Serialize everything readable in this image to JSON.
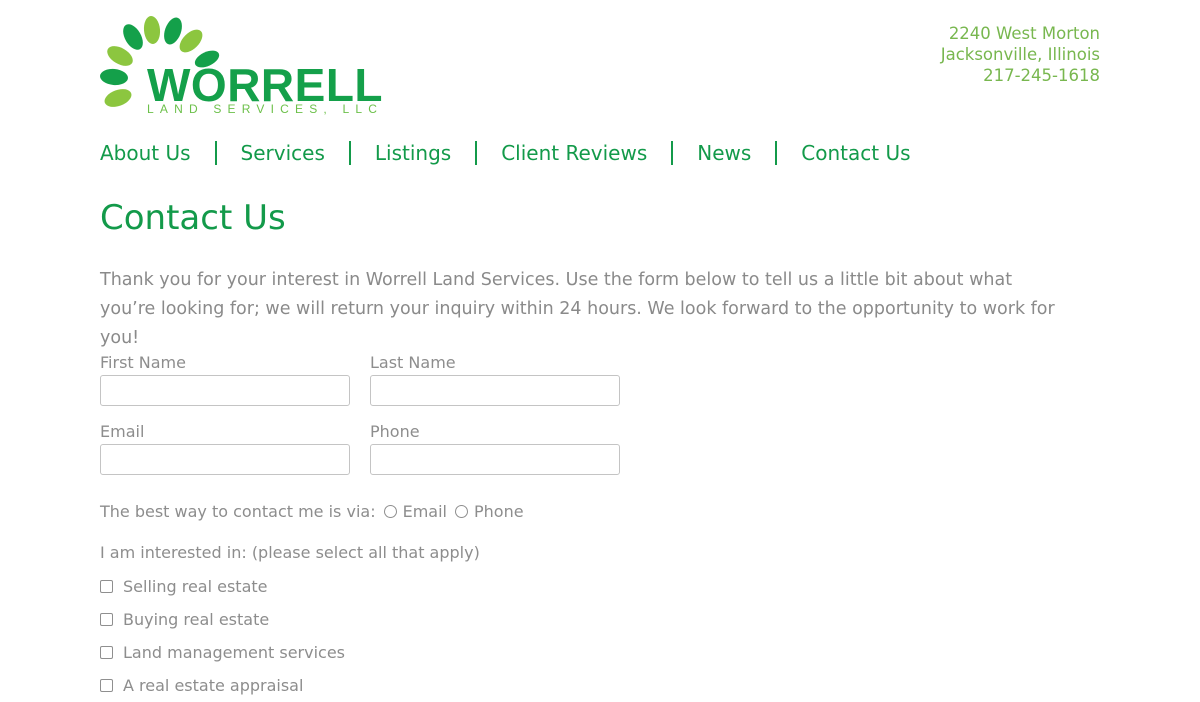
{
  "brand": {
    "name": "WORRELL",
    "subtitle": "LAND SERVICES, LLC",
    "leaf_color_dark": "#14a04a",
    "leaf_color_light": "#8cc63f"
  },
  "address": {
    "street": "2240 West Morton",
    "city": "Jacksonville, Illinois",
    "phone": "217-245-1618"
  },
  "nav": {
    "items": [
      {
        "label": "About Us"
      },
      {
        "label": "Services"
      },
      {
        "label": "Listings"
      },
      {
        "label": "Client Reviews"
      },
      {
        "label": "News"
      },
      {
        "label": "Contact Us"
      }
    ]
  },
  "page": {
    "title": "Contact Us",
    "intro": "Thank you for your interest in Worrell Land Services. Use the form below to tell us a little bit about what you’re looking for; we will return your inquiry within 24 hours. We look forward to the opportunity to work for you!"
  },
  "form": {
    "first_name": {
      "label": "First Name",
      "value": ""
    },
    "last_name": {
      "label": "Last Name",
      "value": ""
    },
    "email": {
      "label": "Email",
      "value": ""
    },
    "phone": {
      "label": "Phone",
      "value": ""
    },
    "contact_pref": {
      "label": "The best way to contact me is via:",
      "options": [
        "Email",
        "Phone"
      ]
    },
    "interests": {
      "label": "I am interested in: (please select all that apply)",
      "options": [
        "Selling real estate",
        "Buying real estate",
        "Land management services",
        "A real estate appraisal"
      ]
    }
  },
  "colors": {
    "accent": "#139a4a",
    "address": "#78b74f",
    "body_text": "#8a8a8a"
  }
}
